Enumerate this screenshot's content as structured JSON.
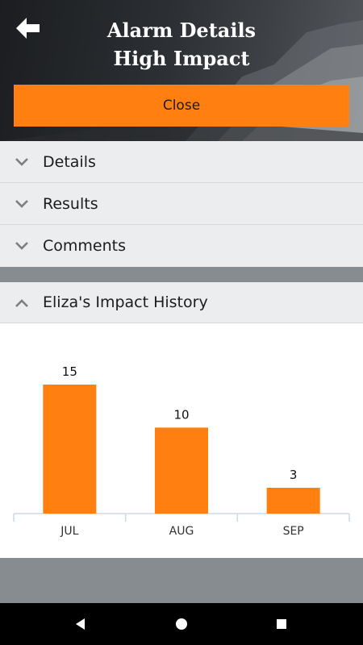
{
  "header": {
    "title_line1": "Alarm Details",
    "title_line2": "High Impact",
    "close_label": "Close"
  },
  "sections": [
    {
      "label": "Details",
      "expanded": false
    },
    {
      "label": "Results",
      "expanded": false
    },
    {
      "label": "Comments",
      "expanded": false
    }
  ],
  "history": {
    "label": "Eliza's Impact History",
    "expanded": true
  },
  "chart_data": {
    "type": "bar",
    "categories": [
      "JUL",
      "AUG",
      "SEP"
    ],
    "values": [
      15,
      10,
      3
    ],
    "title": "",
    "xlabel": "",
    "ylabel": "",
    "ylim": [
      0,
      15
    ],
    "bar_color": "#ff8010",
    "grid": false
  },
  "colors": {
    "accent": "#ff8010",
    "panel": "#ecedee",
    "band": "#878c90"
  },
  "navbar": {
    "back_icon": "triangle-back-icon",
    "home_icon": "circle-home-icon",
    "recents_icon": "square-recents-icon"
  }
}
